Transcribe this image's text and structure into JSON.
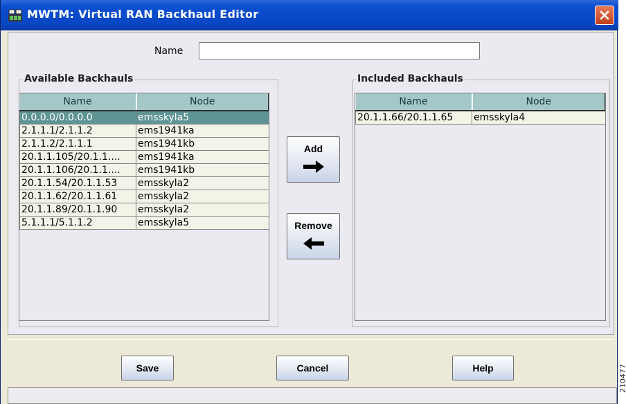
{
  "window": {
    "title": "MWTM: Virtual RAN Backhaul Editor"
  },
  "form": {
    "name_label": "Name",
    "name_value": "",
    "name_placeholder": ""
  },
  "available": {
    "title": "Available Backhauls",
    "columns": [
      "Name",
      "Node"
    ],
    "rows": [
      [
        "0.0.0.0/0.0.0.0",
        "emsskyla5"
      ],
      [
        "2.1.1.1/2.1.1.2",
        "ems1941ka"
      ],
      [
        "2.1.1.2/2.1.1.1",
        "ems1941kb"
      ],
      [
        "20.1.1.105/20.1.1....",
        "ems1941ka"
      ],
      [
        "20.1.1.106/20.1.1....",
        "ems1941kb"
      ],
      [
        "20.1.1.54/20.1.1.53",
        "emsskyla2"
      ],
      [
        "20.1.1.62/20.1.1.61",
        "emsskyla2"
      ],
      [
        "20.1.1.89/20.1.1.90",
        "emsskyla2"
      ],
      [
        "5.1.1.1/5.1.1.2",
        "emsskyla5"
      ]
    ],
    "selected_row": 0
  },
  "included": {
    "title": "Included Backhauls",
    "columns": [
      "Name",
      "Node"
    ],
    "rows": [
      [
        "20.1.1.66/20.1.1.65",
        "emsskyla4"
      ]
    ]
  },
  "actions": {
    "add_label": "Add",
    "remove_label": "Remove"
  },
  "footer": {
    "save_label": "Save",
    "cancel_label": "Cancel",
    "help_label": "Help"
  },
  "figure_id": "210477",
  "icons": {
    "app": "network-app-icon",
    "close": "close-icon",
    "add_arrow": "arrow-right-icon",
    "remove_arrow": "arrow-left-icon"
  },
  "colors": {
    "titlebar": "#0846c3",
    "header_bg": "#a4c8c8",
    "selected_row": "#5f9494",
    "close_button": "#c23f1c"
  }
}
